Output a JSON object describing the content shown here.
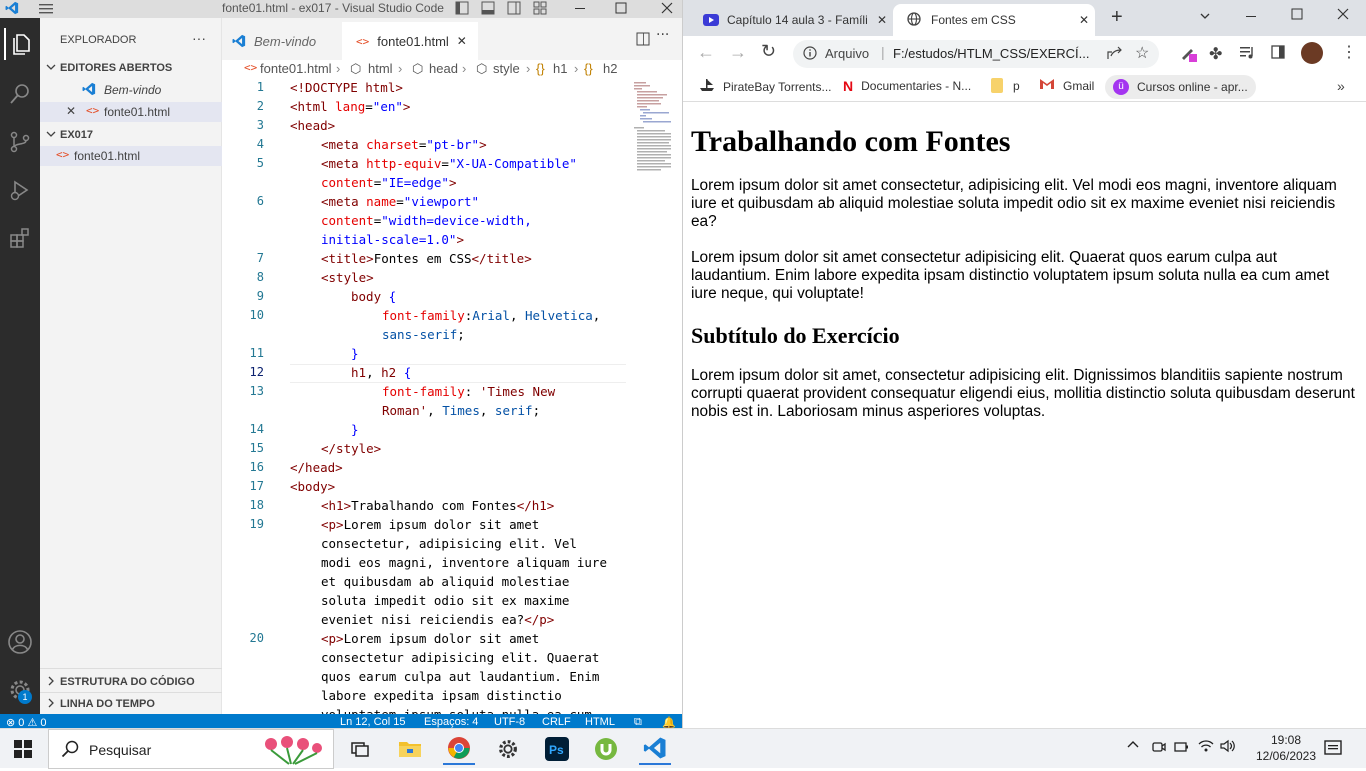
{
  "vscode": {
    "window_title": "fonte01.html - ex017 - Visual Studio Code",
    "explorer_title": "EXPLORADOR",
    "open_editors_title": "EDITORES ABERTOS",
    "open_editors": [
      "Bem-vindo",
      "fonte01.html"
    ],
    "folder_title": "EX017",
    "folder_files": [
      "fonte01.html"
    ],
    "outline_title": "ESTRUTURA DO CÓDIGO",
    "timeline_title": "LINHA DO TEMPO",
    "settings_badge": "1",
    "tabs": [
      "Bem-vindo",
      "fonte01.html"
    ],
    "breadcrumbs": [
      "fonte01.html",
      "html",
      "head",
      "style",
      "h1",
      "h2"
    ],
    "line_numbers": [
      "1",
      "2",
      "3",
      "4",
      "5",
      "6",
      "7",
      "8",
      "9",
      "10",
      "11",
      "12",
      "13",
      "14",
      "15",
      "16",
      "17",
      "18",
      "19",
      "20"
    ],
    "code": {
      "l1": "<!DOCTYPE html>",
      "l2a": "<html ",
      "l2b": "lang",
      "l2c": "=",
      "l2d": "\"en\"",
      "l2e": ">",
      "l3": "<head>",
      "l4a": "<meta ",
      "l4b": "charset",
      "l4c": "=",
      "l4d": "\"pt-br\"",
      "l4e": ">",
      "l5a": "<meta ",
      "l5b": "http-equiv",
      "l5c": "=",
      "l5d": "\"X-UA-Compatible\"",
      "l5f": "content",
      "l5g": "=",
      "l5h": "\"IE=edge\"",
      "l5i": ">",
      "l6a": "<meta ",
      "l6b": "name",
      "l6c": "=",
      "l6d": "\"viewport\"",
      "l6f": "content",
      "l6g": "=",
      "l6h": "\"width=device-width,",
      "l6j": "initial-scale=1.0\"",
      "l6k": ">",
      "l7a": "<title>",
      "l7b": "Fontes em CSS",
      "l7c": "</title>",
      "l8": "<style>",
      "l9a": "body",
      "l9b": " {",
      "l10a": "font-family",
      "l10b": ":",
      "l10c": "Arial",
      "l10d": ", ",
      "l10e": "Helvetica",
      "l10f": ",",
      "l10g": "sans-serif",
      "l10h": ";",
      "l11": "}",
      "l12a": "h1",
      "l12b": ", ",
      "l12c": "h2",
      "l12d": " {",
      "l13a": "font-family",
      "l13b": ": ",
      "l13c": "'Times New",
      "l13d": "Roman'",
      "l13e": ", ",
      "l13f": "Times",
      "l13g": ", ",
      "l13h": "serif",
      "l13i": ";",
      "l14": "}",
      "l15": "</style>",
      "l16": "</head>",
      "l17": "<body>",
      "l18a": "<h1>",
      "l18b": "Trabalhando com Fontes",
      "l18c": "</h1>",
      "l19a": "<p>",
      "l19b": "Lorem ipsum dolor sit amet",
      "l19c": "consectetur, adipisicing elit. Vel",
      "l19d": "modi eos magni, inventore aliquam iure",
      "l19e": "et quibusdam ab aliquid molestiae",
      "l19f": "soluta impedit odio sit ex maxime",
      "l19g": "eveniet nisi reiciendis ea?",
      "l19h": "</p>",
      "l20a": "<p>",
      "l20b": "Lorem ipsum dolor sit amet",
      "l20c": "consectetur adipisicing elit. Quaerat",
      "l20d": "quos earum culpa aut laudantium. Enim",
      "l20e": "labore expedita ipsam distinctio",
      "l20f": "voluptatem ipsum soluta nulla ea cum"
    },
    "status": {
      "problems": "0",
      "warnings": "0",
      "position": "Ln 12, Col 15",
      "spaces": "Espaços: 4",
      "encoding": "UTF-8",
      "eol": "CRLF",
      "language": "HTML"
    }
  },
  "chrome": {
    "tabs": [
      "Capítulo 14 aula 3 - Famíli",
      "Fontes em CSS"
    ],
    "address_label": "Arquivo",
    "address": "F:/estudos/HTLM_CSS/EXERCÍ...",
    "bookmarks": [
      "PirateBay Torrents...",
      "Documentaries - N...",
      "p",
      "Gmail",
      "Cursos online - apr..."
    ],
    "page": {
      "h1": "Trabalhando com Fontes",
      "p1": "Lorem ipsum dolor sit amet consectetur, adipisicing elit. Vel modi eos magni, inventore aliquam iure et quibusdam ab aliquid molestiae soluta impedit odio sit ex maxime eveniet nisi reiciendis ea?",
      "p2": "Lorem ipsum dolor sit amet consectetur adipisicing elit. Quaerat quos earum culpa aut laudantium. Enim labore expedita ipsam distinctio voluptatem ipsum soluta nulla ea cum amet iure neque, qui voluptate!",
      "h2": "Subtítulo do Exercício",
      "p3": "Lorem ipsum dolor sit amet, consectetur adipisicing elit. Dignissimos blanditiis sapiente nostrum corrupti quaerat provident consequatur eligendi eius, mollitia distinctio soluta quibusdam deserunt nobis est in. Laboriosam minus asperiores voluptas."
    }
  },
  "taskbar": {
    "search_label": "Pesquisar",
    "time": "19:08",
    "date": "12/06/2023"
  },
  "colors": {
    "vscode_accent": "#007acc",
    "activity_bar": "#2c2c2c",
    "chrome_tabstrip": "#dee1e6"
  }
}
